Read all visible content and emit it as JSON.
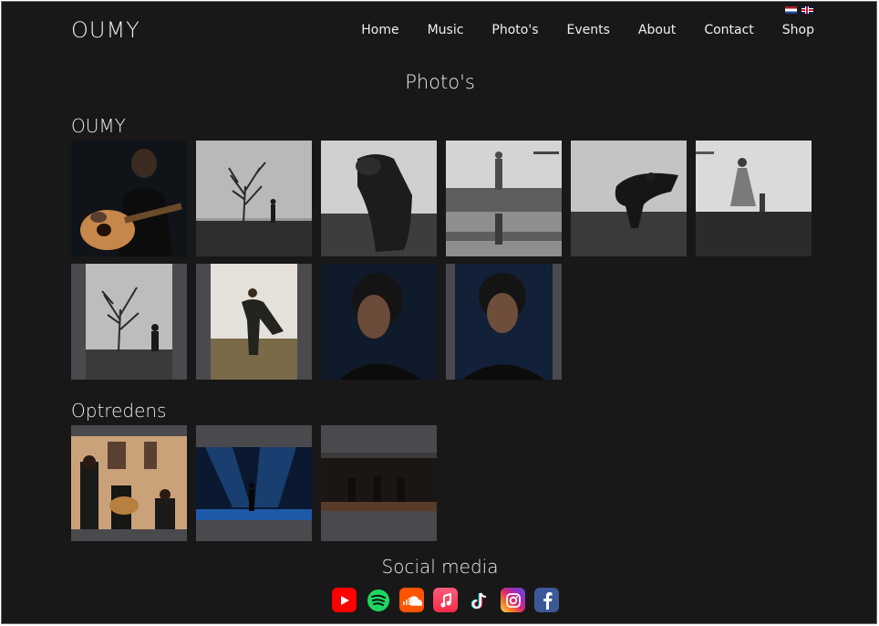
{
  "brand": {
    "logo": "OUMY"
  },
  "languages": [
    {
      "code": "nl",
      "icon": "flag-netherlands-icon"
    },
    {
      "code": "en",
      "icon": "flag-uk-icon"
    }
  ],
  "nav": {
    "items": [
      "Home",
      "Music",
      "Photo's",
      "Events",
      "About",
      "Contact",
      "Shop"
    ]
  },
  "page": {
    "title": "Photo's"
  },
  "gallery_sections": [
    {
      "heading": "OUMY",
      "photo_count": 10,
      "photos": [
        "guitarist-dark-portrait",
        "bare-tree-figure",
        "blurred-figure-cloak",
        "figure-reflection-water",
        "figure-wind-cloak",
        "figure-field-dress",
        "tree-figure-portrait",
        "woman-field-cloak",
        "portrait-blue-left",
        "portrait-blue-right"
      ]
    },
    {
      "heading": "Optredens",
      "photo_count": 3,
      "photos": [
        "live-church-trio",
        "live-stage-blue",
        "live-stage-band"
      ]
    }
  ],
  "social": {
    "heading": "Social media",
    "links": [
      {
        "name": "youtube",
        "icon": "youtube-icon",
        "color": "#ff0000"
      },
      {
        "name": "spotify",
        "icon": "spotify-icon",
        "color": "#1ed760"
      },
      {
        "name": "soundcloud",
        "icon": "soundcloud-icon",
        "color": "#ff5500"
      },
      {
        "name": "apple-music",
        "icon": "apple-music-icon",
        "color": "#fa2d48"
      },
      {
        "name": "tiktok",
        "icon": "tiktok-icon",
        "color": "#111111"
      },
      {
        "name": "instagram",
        "icon": "instagram-icon",
        "color": "#d62976"
      },
      {
        "name": "facebook",
        "icon": "facebook-icon",
        "color": "#3b5998"
      }
    ]
  },
  "colors": {
    "background": "#181818",
    "text": "#ececec",
    "tile_padding": "#4a4a4e"
  }
}
